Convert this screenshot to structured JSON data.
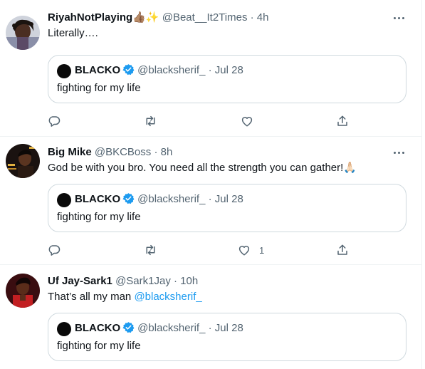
{
  "tweets": [
    {
      "name": "RiyahNotPlaying",
      "name_emoji": "👍🏽✨",
      "handle": "@Beat__It2Times",
      "sep": "·",
      "time": "4h",
      "text": "Literally….",
      "quote": {
        "name": "BLACKO",
        "handle": "@blacksherif_",
        "sep": "·",
        "date": "Jul 28",
        "text": "fighting for my life"
      },
      "actions": {
        "reply_count": "",
        "retweet_count": "",
        "like_count": "",
        "share_count": ""
      }
    },
    {
      "name": "Big Mike",
      "handle": "@BKCBoss",
      "sep": "·",
      "time": "8h",
      "text": "God be with you bro. You need all the strength you can gather!",
      "text_emoji": "🙏🏻",
      "quote": {
        "name": "BLACKO",
        "handle": "@blacksherif_",
        "sep": "·",
        "date": "Jul 28",
        "text": "fighting for my life"
      },
      "actions": {
        "reply_count": "",
        "retweet_count": "",
        "like_count": "1",
        "share_count": ""
      }
    },
    {
      "name": "Uf Jay-Sark1",
      "handle": "@Sark1Jay",
      "sep": "·",
      "time": "10h",
      "text": "That’s all my man ",
      "mention": "@blacksherif_",
      "quote": {
        "name": "BLACKO",
        "handle": "@blacksherif_",
        "sep": "·",
        "date": "Jul 28",
        "text": "fighting for my life"
      }
    }
  ],
  "colors": {
    "accent": "#1d9bf0",
    "muted": "#536471",
    "border": "#cfd9de"
  }
}
